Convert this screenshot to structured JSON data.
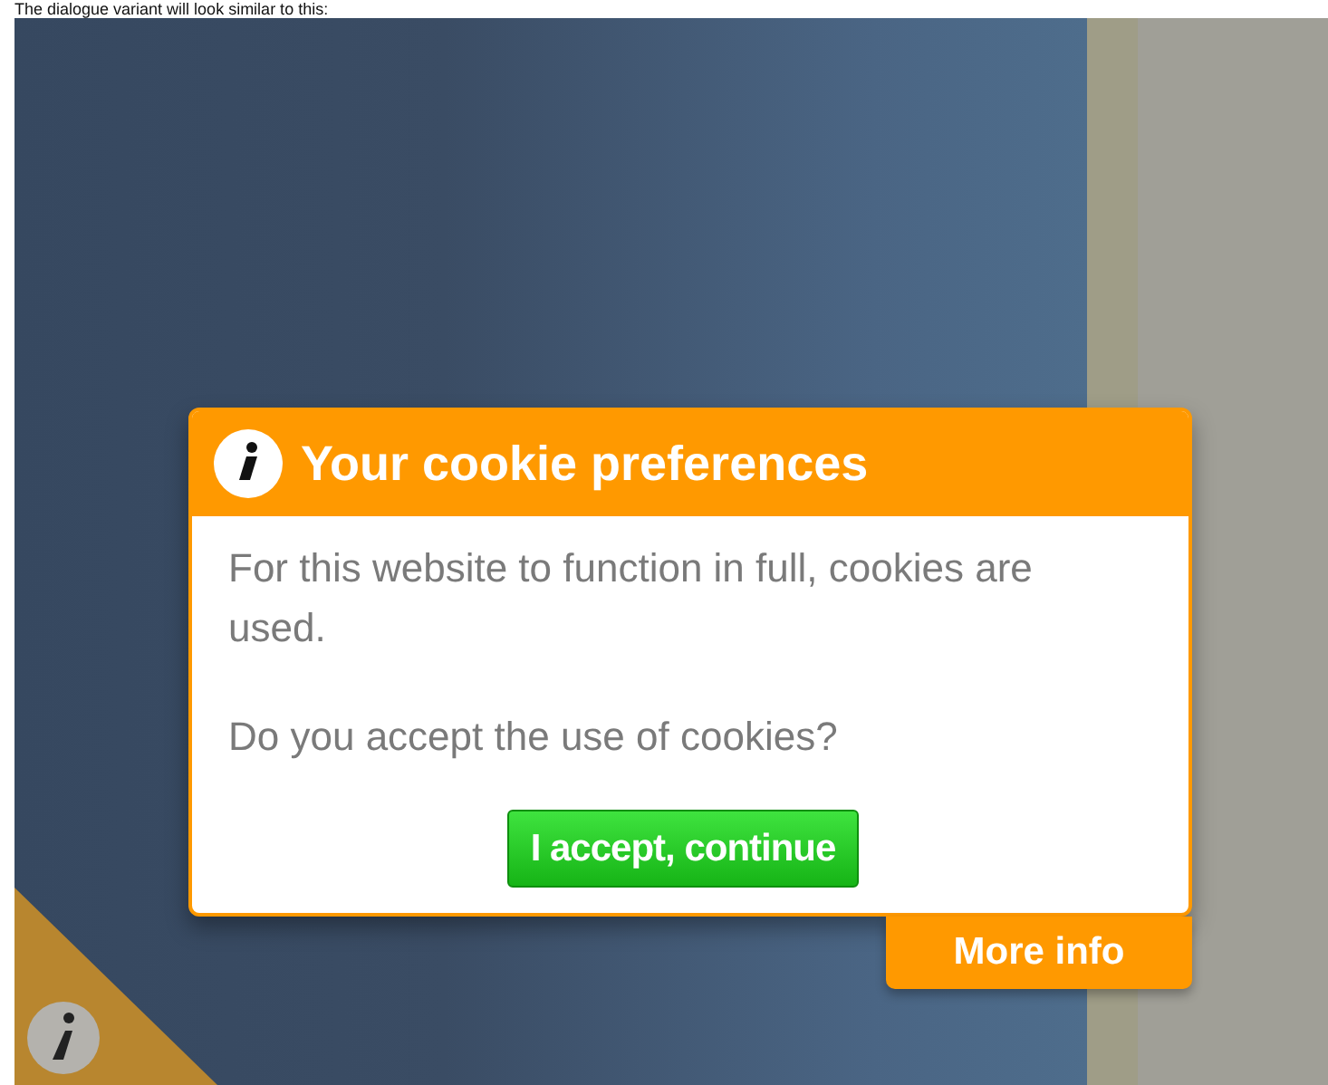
{
  "caption": "The dialogue variant will look similar to this:",
  "dialog": {
    "title": "Your cookie preferences",
    "paragraphs": [
      "For this website to function in full, cookies are used.",
      "Do you accept the use of cookies?"
    ],
    "accept_button": "I accept, continue",
    "more_link": "More info"
  }
}
